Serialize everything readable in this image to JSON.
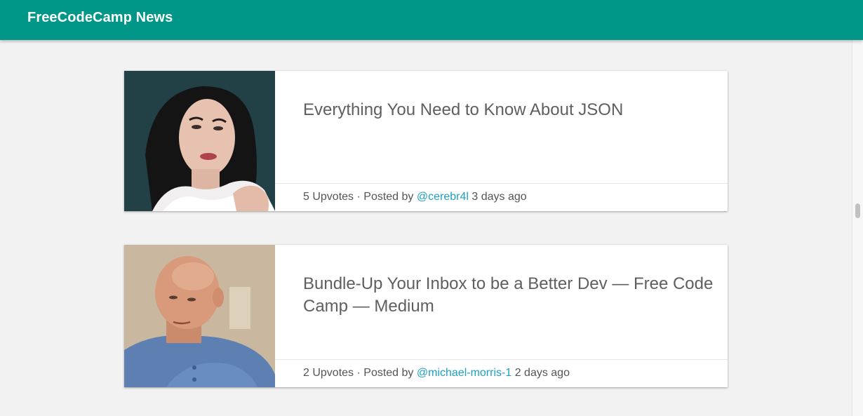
{
  "header": {
    "title": "FreeCodeCamp News",
    "background_color": "#009688"
  },
  "posts": [
    {
      "title": "Everything You Need to Know About JSON",
      "upvotes": "5 Upvotes",
      "separator": " · ",
      "posted_by": "Posted by ",
      "author": "@cerebr4l",
      "time": " 3 days ago",
      "image_icon": "author-avatar-photo"
    },
    {
      "title": "Bundle-Up Your Inbox to be a Better Dev — Free Code Camp — Medium",
      "upvotes": "2 Upvotes",
      "separator": " · ",
      "posted_by": "Posted by ",
      "author": "@michael-morris-1",
      "time": " 2 days ago",
      "image_icon": "author-avatar-photo"
    }
  ],
  "colors": {
    "author_link": "#1ea0c3",
    "title_text": "#5f5f5f",
    "page_background": "#f2f2f2"
  }
}
